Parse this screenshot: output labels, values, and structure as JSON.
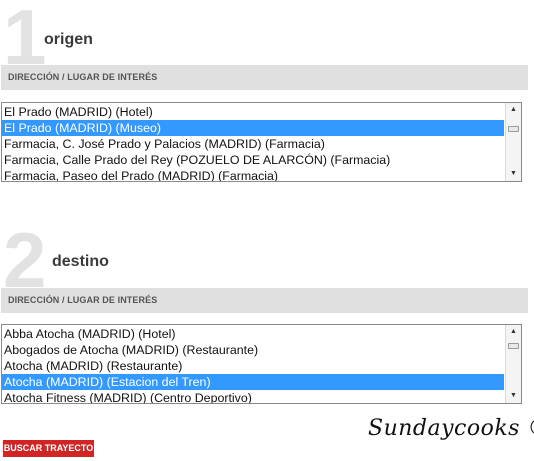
{
  "origin": {
    "step_number": "1",
    "title": "origen",
    "field_label": "DIRECCIÓN / LUGAR DE INTERÉS",
    "options": [
      {
        "label": "El Prado (MADRID) (Hotel)",
        "selected": false
      },
      {
        "label": "El Prado (MADRID) (Museo)",
        "selected": true
      },
      {
        "label": "Farmacia, C. José Prado y Palacios (MADRID) (Farmacia)",
        "selected": false
      },
      {
        "label": "Farmacia, Calle Prado del Rey (POZUELO DE ALARCÓN) (Farmacia)",
        "selected": false
      },
      {
        "label": "Farmacia, Paseo del Prado (MADRID) (Farmacia)",
        "selected": false
      }
    ]
  },
  "destination": {
    "step_number": "2",
    "title": "destino",
    "field_label": "DIRECCIÓN / LUGAR DE INTERÉS",
    "options": [
      {
        "label": "Abba Atocha (MADRID) (Hotel)",
        "selected": false
      },
      {
        "label": "Abogados de Atocha (MADRID) (Restaurante)",
        "selected": false
      },
      {
        "label": "Atocha (MADRID) (Restaurante)",
        "selected": false
      },
      {
        "label": "Atocha (MADRID) (Estacion del Tren)",
        "selected": true
      },
      {
        "label": "Atocha Fitness (MADRID) (Centro Deportivo)",
        "selected": false
      }
    ]
  },
  "search_button": {
    "label": "BUSCAR TRAYECTO"
  },
  "watermark": "Sundaycooks ©",
  "icons": {
    "scroll_up": "triangle-up-icon",
    "scroll_down": "triangle-down-icon"
  },
  "colors": {
    "selection": "#3399ff",
    "button": "#d12525",
    "field_bar": "#e0e0e0",
    "step_number": "#e2e2e2"
  }
}
